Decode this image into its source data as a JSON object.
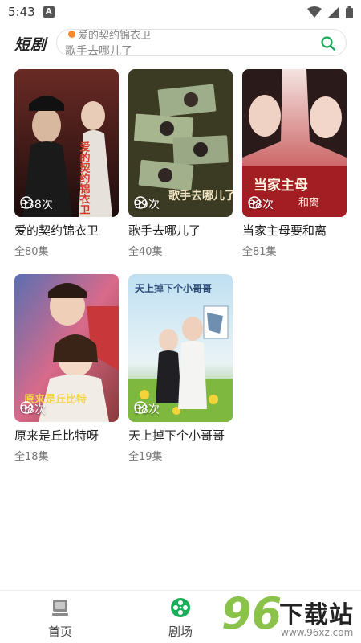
{
  "status_bar": {
    "time": "5:43",
    "notification_letter": "A"
  },
  "header": {
    "brand": "短剧",
    "search_top_text": "爱的契约锦衣卫",
    "search_text": "歌手去哪儿了"
  },
  "cards": [
    {
      "title": "爱的契约锦衣卫",
      "plays": "338次",
      "episodes": "全80集",
      "poster_text": "爱的契约锦衣卫"
    },
    {
      "title": "歌手去哪儿了",
      "plays": "99次",
      "episodes": "全40集",
      "poster_text": "歌手去哪儿了"
    },
    {
      "title": "当家主母要和离",
      "plays": "88次",
      "episodes": "全81集",
      "poster_text": "当家主母和离"
    },
    {
      "title": "原来是丘比特呀",
      "plays": "68次",
      "episodes": "全18集",
      "poster_text": "原来是丘比特"
    },
    {
      "title": "天上掉下个小哥哥",
      "plays": "58次",
      "episodes": "全19集",
      "poster_text": "天上掉下个小哥哥"
    }
  ],
  "nav": {
    "home_label": "首页",
    "theater_label": "剧场"
  },
  "watermark": {
    "logo_number": "96",
    "logo_text": "下载站",
    "url": "www.96xz.com"
  },
  "colors": {
    "accent_green": "#1aad5a",
    "watermark_green": "#8bc34a"
  }
}
